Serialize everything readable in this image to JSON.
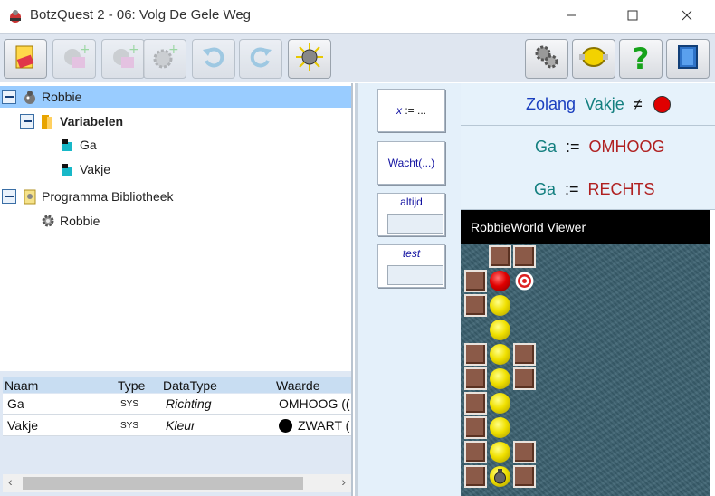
{
  "window": {
    "title": "BotzQuest 2 - 06: Volg De Gele Weg",
    "minimize_glyph": "—",
    "maximize_glyph": "☐",
    "close_glyph": "✕"
  },
  "toolbar": {
    "left": [
      {
        "name": "eraser-icon",
        "enabled": true
      },
      {
        "name": "add-robot-pink-icon",
        "enabled": false
      },
      {
        "name": "add-robot-pink-icon",
        "enabled": false
      },
      {
        "name": "add-gear-icon",
        "enabled": false
      },
      {
        "name": "undo-icon",
        "enabled": false
      },
      {
        "name": "redo-icon",
        "enabled": false
      },
      {
        "name": "bomb-spark-icon",
        "enabled": true
      }
    ],
    "right": [
      {
        "name": "gears-icon"
      },
      {
        "name": "coin-icon"
      },
      {
        "name": "help-icon"
      },
      {
        "name": "exit-door-icon"
      }
    ],
    "help_glyph": "?"
  },
  "tree": {
    "root": {
      "label": "Robbie"
    },
    "variables": {
      "label": "Variabelen"
    },
    "var_items": [
      {
        "label": "Ga"
      },
      {
        "label": "Vakje"
      }
    ],
    "library": {
      "label": "Programma Bibliotheek"
    },
    "library_items": [
      {
        "label": "Robbie"
      }
    ]
  },
  "grid": {
    "headers": [
      "Naam",
      "Type",
      "DataType",
      "Waarde"
    ],
    "rows": [
      {
        "naam": "Ga",
        "type": "SYS",
        "datatype": "Richting",
        "waarde": "OMHOOG (("
      },
      {
        "naam": "Vakje",
        "type": "SYS",
        "datatype": "Kleur",
        "waarde": "ZWART ("
      }
    ],
    "scroll_left": "‹",
    "scroll_right": "›"
  },
  "palette": {
    "assign_var": "x",
    "assign_op": " := ...",
    "wait": "Wacht(...)",
    "always": "altijd",
    "test": "test"
  },
  "program": {
    "while_kw": "Zolang",
    "while_var": "Vakje",
    "neq": "≠",
    "line2": {
      "var": "Ga",
      "op": ":=",
      "val": "OMHOOG"
    },
    "line3": {
      "var": "Ga",
      "op": ":=",
      "val": "RECHTS"
    }
  },
  "viewer": {
    "title": "RobbieWorld Viewer"
  },
  "colors": {
    "red_dot": "#e00000",
    "selection": "#99ccff",
    "keyword_blue": "#1a3fbf",
    "var_teal": "#137f7f",
    "value_red": "#b02020"
  }
}
